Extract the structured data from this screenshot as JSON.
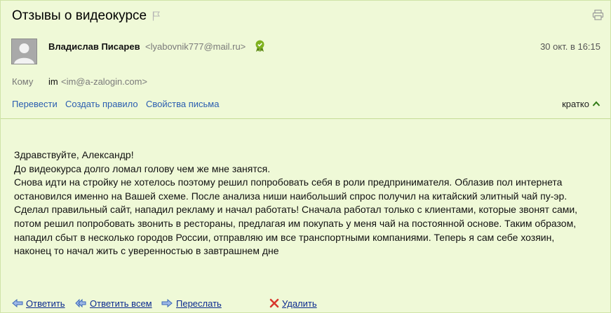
{
  "message": {
    "subject": "Отзывы о видеокурсе",
    "sender_name": "Владислав Писарев",
    "sender_email": "<lyabovnik777@mail.ru>",
    "date": "30 окт. в 16:15",
    "to_label": "Кому",
    "to_name": "im",
    "to_email": "<im@a-zalogin.com>"
  },
  "actions": {
    "translate": "Перевести",
    "create_rule": "Создать правило",
    "properties": "Свойства письма",
    "compact": "кратко"
  },
  "body": {
    "lines": [
      "Здравствуйте, Александр!",
      "До видеокурса долго ломал голову чем же мне занятся.",
      "Снова идти на стройку не хотелось поэтому решил попробовать себя в роли предпринимателя. Облазив пол интернета",
      "остановился именно на Вашей схеме. После анализа ниши наибольший спрос получил на китайский элитный чай пу-эр.",
      "Сделал правильный сайт, нападил рекламу и начал работать! Сначала работал только с клиентами, которые звонят сами,",
      "потом решил попробовать звонить в рестораны, предлагая им покупать у меня чай на постоянной основе. Таким образом,",
      "нападил сбыт в несколько городов России, отправляю им все транспортными компаниями. Теперь я сам себе хозяин,",
      "наконец то начал жить с уверенностью в завтрашнем дне"
    ]
  },
  "bottom_actions": {
    "reply": "Ответить",
    "reply_all": "Ответить всем",
    "forward": "Переслать",
    "delete": "Удалить"
  },
  "icons": {
    "flag": "flag-icon",
    "print": "printer-icon",
    "verified": "verified-sender-icon",
    "chevron": "chevron-up-icon",
    "reply": "reply-arrow-icon",
    "reply_all": "reply-all-arrow-icon",
    "forward": "forward-arrow-icon",
    "delete": "delete-cross-icon"
  },
  "colors": {
    "background": "#eff9d7",
    "link": "#2a5db0",
    "bottom_link": "#0b2a8f",
    "delete_icon": "#d8382e",
    "verified": "#7fb21f"
  }
}
